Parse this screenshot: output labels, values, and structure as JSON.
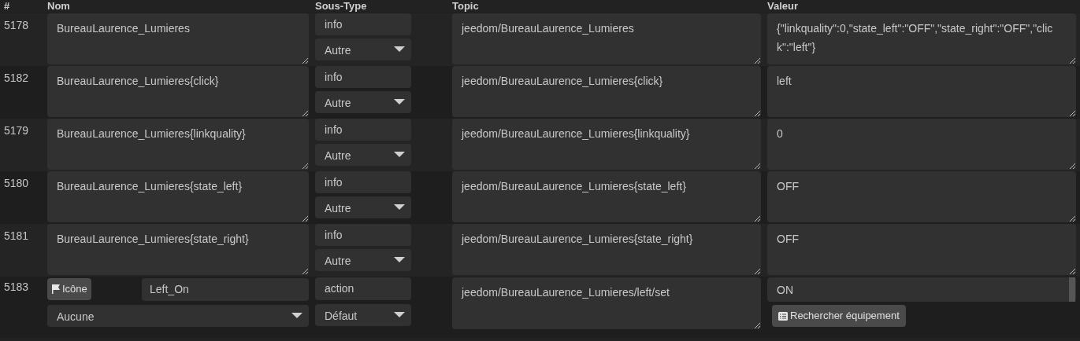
{
  "header": [
    "#",
    "Nom",
    "Sous-Type",
    "Topic",
    "Valeur"
  ],
  "rows": [
    {
      "kind": "info",
      "id": "5178",
      "name": "BureauLaurence_Lumieres",
      "type": "info",
      "subtype": "Autre",
      "topic": "jeedom/BureauLaurence_Lumieres",
      "value": "{\"linkquality\":0,\"state_left\":\"OFF\",\"state_right\":\"OFF\",\"click\":\"left\"}"
    },
    {
      "kind": "info",
      "id": "5182",
      "name": "BureauLaurence_Lumieres{click}",
      "type": "info",
      "subtype": "Autre",
      "topic": "jeedom/BureauLaurence_Lumieres{click}",
      "value": "left"
    },
    {
      "kind": "info",
      "id": "5179",
      "name": "BureauLaurence_Lumieres{linkquality}",
      "type": "info",
      "subtype": "Autre",
      "topic": "jeedom/BureauLaurence_Lumieres{linkquality}",
      "value": "0"
    },
    {
      "kind": "info",
      "id": "5180",
      "name": "BureauLaurence_Lumieres{state_left}",
      "type": "info",
      "subtype": "Autre",
      "topic": "jeedom/BureauLaurence_Lumieres{state_left}",
      "value": "OFF"
    },
    {
      "kind": "info",
      "id": "5181",
      "name": "BureauLaurence_Lumieres{state_right}",
      "type": "info",
      "subtype": "Autre",
      "topic": "jeedom/BureauLaurence_Lumieres{state_right}",
      "value": "OFF"
    },
    {
      "kind": "action",
      "id": "5183",
      "icon_button": "Icône",
      "name": "Left_On",
      "icon_select": "Aucune",
      "type": "action",
      "subtype": "Défaut",
      "topic": "jeedom/BureauLaurence_Lumieres/left/set",
      "value": "ON",
      "search_button": "Rechercher équipement"
    }
  ]
}
